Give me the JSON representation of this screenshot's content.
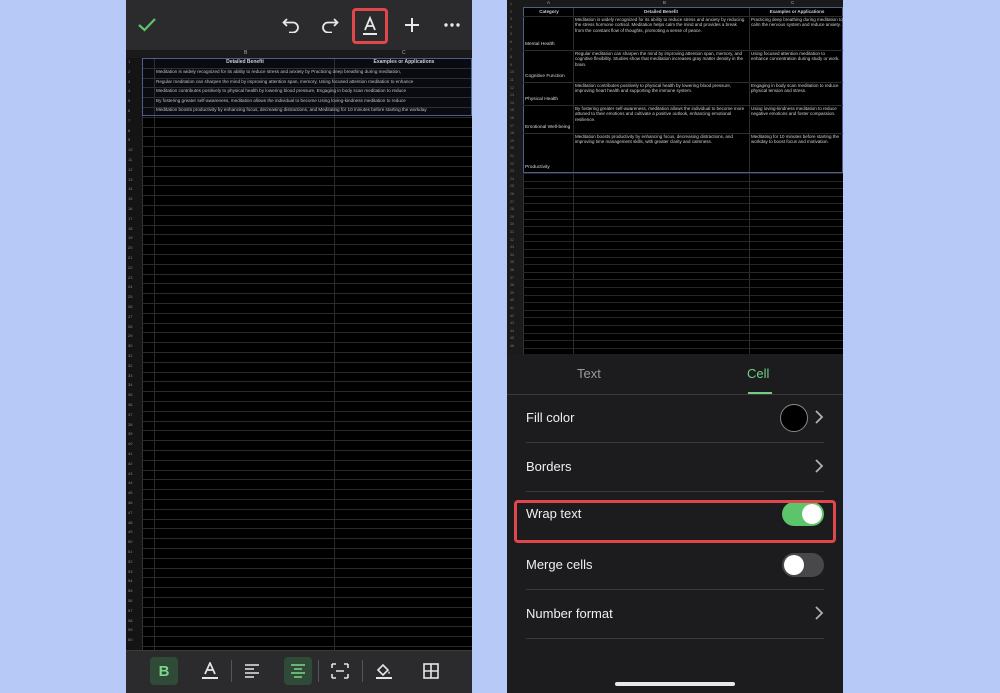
{
  "left_screen": {
    "toolbar": {
      "confirm_icon": "checkmark-icon",
      "undo_icon": "undo-icon",
      "redo_icon": "redo-icon",
      "format_icon": "text-format-icon",
      "add_icon": "plus-icon",
      "more_icon": "more-icon",
      "accent": "#5cc46b",
      "highlight": "#e0474c"
    },
    "sheet": {
      "col_b_header": "Detailed Benefit",
      "col_c_header": "Examples or Applications",
      "column_letters": [
        "B",
        "C"
      ],
      "row_numbers": [
        "1",
        "2",
        "3",
        "4",
        "5",
        "6",
        "7",
        "8",
        "9",
        "10",
        "11",
        "12",
        "13",
        "14",
        "15",
        "16",
        "17",
        "18",
        "19",
        "20",
        "21",
        "22",
        "23",
        "24",
        "25",
        "26",
        "27",
        "28",
        "29",
        "30",
        "31",
        "32",
        "33",
        "34",
        "35",
        "36",
        "37",
        "38",
        "39",
        "40",
        "41",
        "42",
        "43",
        "44",
        "45",
        "46",
        "47",
        "48",
        "49",
        "50",
        "51",
        "52",
        "53",
        "54",
        "55",
        "56",
        "57",
        "58",
        "59",
        "60"
      ],
      "lines": [
        "Meditation is widely recognized for its ability to reduce stress and anxiety by   Practicing deep breathing during meditation, ",
        "Regular meditation can sharpen the mind by improving attention span, memory,   Using focused attention meditation to enhance ",
        "Meditation contributes positively to physical health by lowering blood pressure,   Engaging in body scan meditation to reduce ",
        "By fostering greater self-awareness, meditation allows the individual to become   Using loving-kindness meditation to reduce ",
        "Meditation boosts productivity by enhancing focus, decreasing distractions, and   Meditating for 10 minutes before starting the workday "
      ]
    },
    "bottom_toolbar": {
      "bold_label": "B",
      "text_color_icon": "text-color-icon",
      "align_left_icon": "align-left-icon",
      "align_center_icon": "align-center-icon",
      "wrap_icon": "wrap-icon",
      "fill_icon": "fill-bucket-icon",
      "borders_icon": "borders-icon"
    }
  },
  "right_screen": {
    "sheet": {
      "column_letters": [
        "A",
        "B",
        "C"
      ],
      "headers": [
        "Category",
        "Detailed Benefit",
        "Examples or Applications"
      ],
      "rows": [
        {
          "category": "Mental Health",
          "benefit": "Meditation is widely recognized for its ability to reduce stress and anxiety by reducing the stress hormone cortisol. Meditation helps calm the mind and provides a break from the constant flow of thoughts, promoting a sense of peace.",
          "example": "Practicing deep breathing during meditation to calm the nervous system and reduce anxiety."
        },
        {
          "category": "Cognitive Function",
          "benefit": "Regular meditation can sharpen the mind by improving attention span, memory, and cognitive flexibility. Studies show that meditation increases gray matter density in the brain.",
          "example": "Using focused attention meditation to enhance concentration during study or work."
        },
        {
          "category": "Physical Health",
          "benefit": "Meditation contributes positively to physical health by lowering blood pressure, improving heart health and supporting the immune system.",
          "example": "Engaging in body scan meditation to reduce physical tension and stress."
        },
        {
          "category": "Emotional Well-being",
          "benefit": "By fostering greater self-awareness, meditation allows the individual to become more attuned to their emotions and cultivate a positive outlook, enhancing emotional resilience.",
          "example": "Using loving-kindness meditation to reduce negative emotions and foster compassion."
        },
        {
          "category": "Productivity",
          "benefit": "Meditation boosts productivity by enhancing focus, decreasing distractions, and improving time management skills, with greater clarity and calmness.",
          "example": "Meditating for 10 minutes before starting the workday to boost focus and motivation."
        }
      ]
    },
    "panel": {
      "tabs": [
        {
          "label": "Text",
          "active": false
        },
        {
          "label": "Cell",
          "active": true
        }
      ],
      "rows": {
        "fill_color": "Fill color",
        "borders": "Borders",
        "wrap_text": "Wrap text",
        "merge_cells": "Merge cells",
        "number_format": "Number format"
      },
      "wrap_text_on": true,
      "merge_cells_on": false,
      "fill_swatch_color": "#000000",
      "toggle_on_color": "#5cc46b",
      "toggle_off_color": "#48484a",
      "tab_active_color": "#6fcf86",
      "tab_inactive_color": "#9a9a9a",
      "highlight": "#e0474c"
    }
  }
}
